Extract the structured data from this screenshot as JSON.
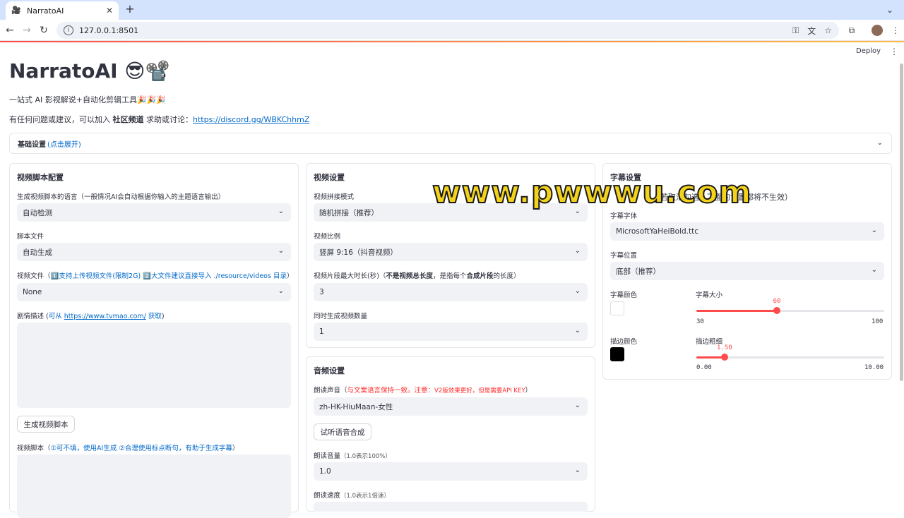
{
  "browser": {
    "tab_title": "NarratoAI",
    "url": "127.0.0.1:8501"
  },
  "header": {
    "deploy_label": "Deploy"
  },
  "main": {
    "title": "NarratoAI 😎📽️",
    "subtitle": "一站式 AI 影视解说+自动化剪辑工具🎉🎉🎉",
    "community_prefix": "有任何问题或建议，可以加入 ",
    "community_bold": "社区频道",
    "community_mid": " 求助或讨论：",
    "community_link": "https://discord.gg/WBKChhmZ"
  },
  "basic_settings": {
    "label": "基础设置",
    "hint": "(点击展开)"
  },
  "script_panel": {
    "title": "视频脚本配置",
    "language_label": "生成视频脚本的语言（一般情况AI会自动根据你输入的主题语言输出）",
    "language_value": "自动检测",
    "script_file_label": "脚本文件",
    "script_file_value": "自动生成",
    "video_file_label_prefix": "视频文件（",
    "video_file_label_blue": "1️⃣支持上传视频文件(限制2G) 2️⃣大文件建议直接导入 ./resource/videos 目录",
    "video_file_label_suffix": "）",
    "video_file_value": "None",
    "plot_label_prefix": "剧情描述 (",
    "plot_label_blue1": "可从 ",
    "plot_label_link": "https://www.tvmao.com/",
    "plot_label_blue2": " 获取",
    "plot_label_suffix": ")",
    "generate_button": "生成视频脚本",
    "script_label_prefix": "视频脚本（",
    "script_label_blue": "①可不填，使用AI生成 ②合理使用标点断句，有助于生成字幕",
    "script_label_suffix": "）"
  },
  "video_panel": {
    "title": "视频设置",
    "concat_label": "视频拼接模式",
    "concat_value": "随机拼接（推荐）",
    "ratio_label": "视频比例",
    "ratio_value": "竖屏 9:16（抖音视频）",
    "clip_label_prefix": "视频片段最大时长(秒)（",
    "clip_label_bold1": "不是视频总长度",
    "clip_label_mid": "，是指每个",
    "clip_label_bold2": "合成片段",
    "clip_label_suffix": "的长度）",
    "clip_value": "3",
    "count_label": "同时生成视频数量",
    "count_value": "1"
  },
  "audio_panel": {
    "title": "音频设置",
    "voice_label_prefix": "朗读声音（",
    "voice_label_red": "与文案语言保持一致。注意：",
    "voice_label_red2": "V2版效果更好，但是需要API KEY",
    "voice_label_suffix": "）",
    "voice_value": "zh-HK-HiuMaan-女性",
    "preview_button": "试听语音合成",
    "volume_label": "朗读音量",
    "volume_hint": "（1.0表示100%）",
    "volume_value": "1.0",
    "speed_label": "朗读速度",
    "speed_hint": "（1.0表示1倍速）"
  },
  "subtitle_panel": {
    "title": "字幕设置",
    "enable_label_partial": "（若取消勾选，下面的设置都将不生效）",
    "font_label": "字幕字体",
    "font_value": "MicrosoftYaHeiBold.ttc",
    "position_label": "字幕位置",
    "position_value": "底部（推荐）",
    "color_label": "字幕颜色",
    "color_value": "#FFFFFF",
    "size_label": "字幕大小",
    "size_value": 60,
    "size_value_text": "60",
    "size_min": 30,
    "size_min_text": "30",
    "size_max": 100,
    "size_max_text": "100",
    "stroke_color_label": "描边颜色",
    "stroke_color_value": "#000000",
    "stroke_width_label": "描边粗细",
    "stroke_width_value": 1.5,
    "stroke_width_value_text": "1.50",
    "stroke_min": 0,
    "stroke_min_text": "0.00",
    "stroke_max": 10,
    "stroke_max_text": "10.00"
  },
  "overlay": {
    "watermark": "www.pwwwu.com"
  },
  "icons": {
    "favicon": "film-camera-icon",
    "close": "close-icon",
    "chevron": "chevron-down-icon"
  }
}
